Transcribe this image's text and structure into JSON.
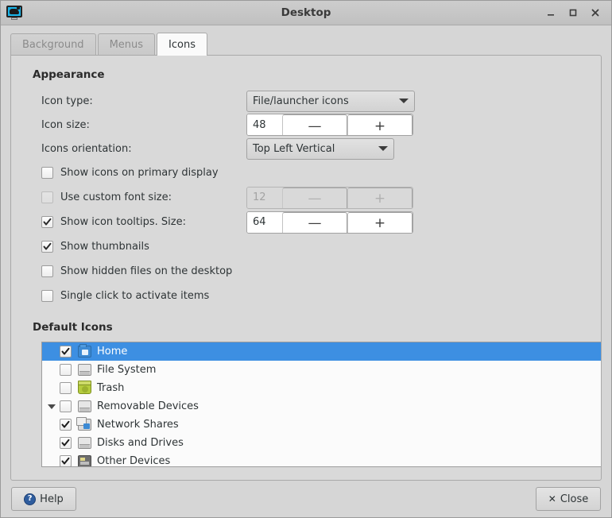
{
  "window": {
    "title": "Desktop",
    "app_icon": "display-icon",
    "controls": [
      {
        "name": "minimize-button",
        "glyph": "minimize-icon"
      },
      {
        "name": "maximize-button",
        "glyph": "maximize-icon"
      },
      {
        "name": "close-button",
        "glyph": "close-icon"
      }
    ]
  },
  "tabs": [
    {
      "label": "Background",
      "active": false
    },
    {
      "label": "Menus",
      "active": false
    },
    {
      "label": "Icons",
      "active": true
    }
  ],
  "appearance": {
    "heading": "Appearance",
    "icon_type": {
      "label": "Icon type:",
      "value": "File/launcher icons"
    },
    "icon_size": {
      "label": "Icon size:",
      "value": "48",
      "minus": "—",
      "plus": "+"
    },
    "icons_orientation": {
      "label": "Icons orientation:",
      "value": "Top Left Vertical"
    },
    "options": [
      {
        "label": "Show icons on primary display",
        "checked": false,
        "enabled": true
      },
      {
        "label": "Use custom font size:",
        "checked": false,
        "enabled": true
      },
      {
        "label": "Show icon tooltips. Size:",
        "checked": true,
        "enabled": true
      },
      {
        "label": "Show thumbnails",
        "checked": true,
        "enabled": true
      },
      {
        "label": "Show hidden files on the desktop",
        "checked": false,
        "enabled": true
      },
      {
        "label": "Single click to activate items",
        "checked": false,
        "enabled": true
      }
    ],
    "font_size_spin": {
      "value": "12",
      "minus": "—",
      "plus": "+",
      "enabled": false
    },
    "tooltip_size_spin": {
      "value": "64",
      "minus": "—",
      "plus": "+",
      "enabled": true
    }
  },
  "default_icons": {
    "heading": "Default Icons",
    "items": [
      {
        "label": "Home",
        "checked": true,
        "selected": true,
        "icon": "folder-home-icon",
        "depth": 0,
        "expander": false
      },
      {
        "label": "File System",
        "checked": false,
        "selected": false,
        "icon": "drive-icon",
        "depth": 0,
        "expander": false
      },
      {
        "label": "Trash",
        "checked": false,
        "selected": false,
        "icon": "trash-icon",
        "depth": 0,
        "expander": false
      },
      {
        "label": "Removable Devices",
        "checked": false,
        "selected": false,
        "icon": "drive-icon",
        "depth": 0,
        "expander": true,
        "expanded": true
      },
      {
        "label": "Network Shares",
        "checked": true,
        "selected": false,
        "icon": "network-icon",
        "depth": 1,
        "expander": false
      },
      {
        "label": "Disks and Drives",
        "checked": true,
        "selected": false,
        "icon": "drive-icon",
        "depth": 1,
        "expander": false
      },
      {
        "label": "Other Devices",
        "checked": true,
        "selected": false,
        "icon": "device-icon",
        "depth": 1,
        "expander": false
      }
    ]
  },
  "footer": {
    "help_label": "Help",
    "help_icon": "help-circle-icon",
    "close_label": "Close",
    "close_icon": "close-x-icon"
  },
  "colors": {
    "selection_blue": "#3d8fe2",
    "window_bg": "#d6d6d6",
    "content_bg": "#d9d9d9",
    "list_bg": "#fbfbfb",
    "text": "#2e3436",
    "tab_inactive_text": "#8b8b8b"
  }
}
